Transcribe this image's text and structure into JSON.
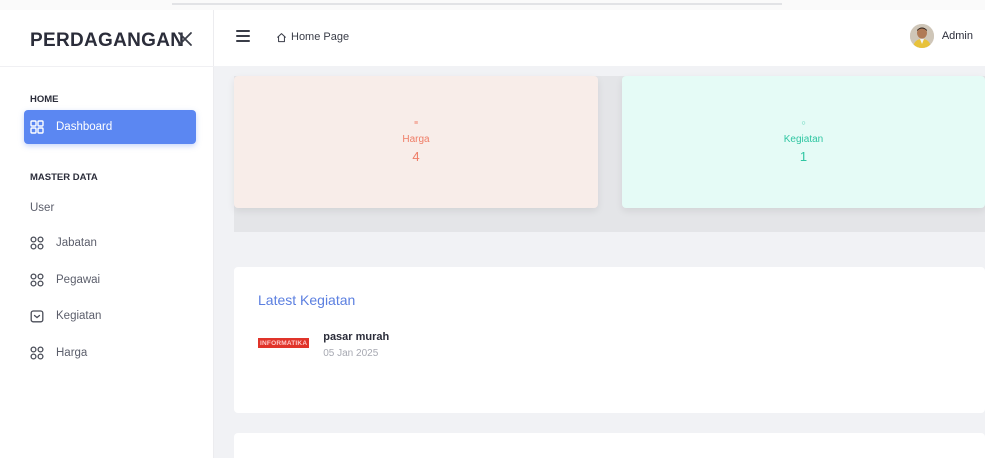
{
  "sidebar": {
    "brand": "PERDAGANGAN",
    "sections": [
      {
        "title": "HOME"
      },
      {
        "title": "MASTER DATA"
      }
    ],
    "items": [
      {
        "label": "Dashboard",
        "icon": "grid-icon"
      },
      {
        "label": "User"
      },
      {
        "label": "Jabatan",
        "icon": "grid-icon"
      },
      {
        "label": "Pegawai",
        "icon": "grid-icon"
      },
      {
        "label": "Kegiatan",
        "icon": "calendar-icon"
      },
      {
        "label": "Harga",
        "icon": "grid-icon"
      }
    ]
  },
  "header": {
    "breadcrumb": "Home Page",
    "username": "Admin"
  },
  "stats": [
    {
      "label": "Harga",
      "value": "4",
      "icon": "tag-icon"
    },
    {
      "label": "Kegiatan",
      "value": "1",
      "icon": "circle-icon"
    }
  ],
  "latest": {
    "title": "Latest Kegiatan",
    "items": [
      {
        "badge": "INFORMATIKA",
        "title": "pasar murah",
        "date": "05 Jan 2025"
      }
    ]
  },
  "colors": {
    "accent": "#5b87f2",
    "harga": "#ef7d67",
    "kegiatan": "#2fc6a2",
    "badge": "#e0342a"
  }
}
